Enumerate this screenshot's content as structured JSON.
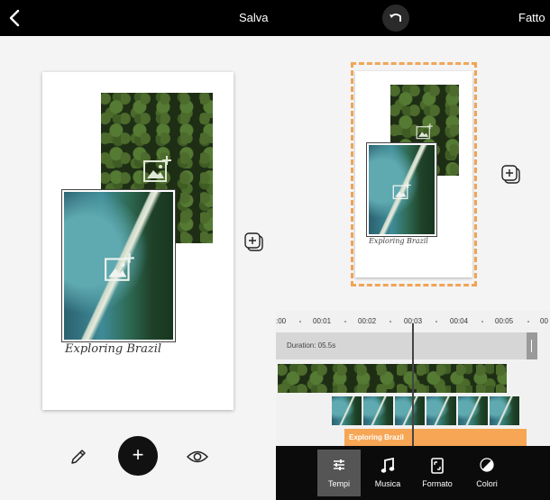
{
  "topbar": {
    "save_label": "Salva",
    "done_label": "Fatto",
    "icons": {
      "back": "back-chevron-icon",
      "undo": "undo-icon"
    }
  },
  "canvas": {
    "caption": "Exploring Brazil",
    "icons": {
      "add_image": "add-image-icon",
      "add_layer": "add-layer-icon"
    }
  },
  "editor_tools": {
    "icons": {
      "edit": "pencil-icon",
      "add": "plus-icon",
      "preview": "eye-icon"
    },
    "add_symbol": "+"
  },
  "preview": {
    "caption": "Exploring Brazil",
    "selection_color": "#f0a556"
  },
  "timeline": {
    "ticks": [
      ":00",
      "00:01",
      "00:02",
      "00:03",
      "00:04",
      "00:05",
      "00"
    ],
    "duration_label": "Duration: 05.5s",
    "text_track_label": "Exploring Brazil",
    "accent_color": "#f6a654"
  },
  "toolbar": {
    "items": [
      {
        "label": "Tempi",
        "icon": "sliders-icon",
        "active": true
      },
      {
        "label": "Musica",
        "icon": "music-note-icon",
        "active": false
      },
      {
        "label": "Formato",
        "icon": "format-frame-icon",
        "active": false
      },
      {
        "label": "Colori",
        "icon": "color-circle-icon",
        "active": false
      }
    ]
  }
}
